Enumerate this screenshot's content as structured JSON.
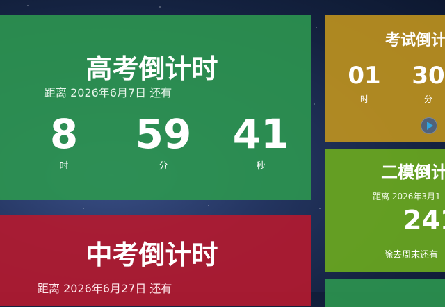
{
  "gaokao": {
    "title": "高考倒计时",
    "subtitle": "距离 2026年6月7日 还有",
    "hours": "8",
    "hours_unit": "时",
    "minutes": "59",
    "minutes_unit": "分",
    "seconds": "41",
    "seconds_unit": "秒"
  },
  "zhongkao": {
    "title": "中考倒计时",
    "subtitle": "距离 2026年6月27日 还有"
  },
  "kaoshi": {
    "title": "考试倒计",
    "value_a": "01",
    "unit_a": "时",
    "value_b": "30",
    "unit_b": "分",
    "play_icon": "play-icon"
  },
  "ermo": {
    "title": "二模倒计",
    "subtitle": "距离 2026年3月1",
    "value": "241",
    "note": "除去周末还有"
  },
  "colors": {
    "gaokao_bg": "#2c9650",
    "zhongkao_bg": "#b21a30",
    "kaoshi_bg": "#c4961e",
    "ermo_bg": "#6aa820"
  }
}
